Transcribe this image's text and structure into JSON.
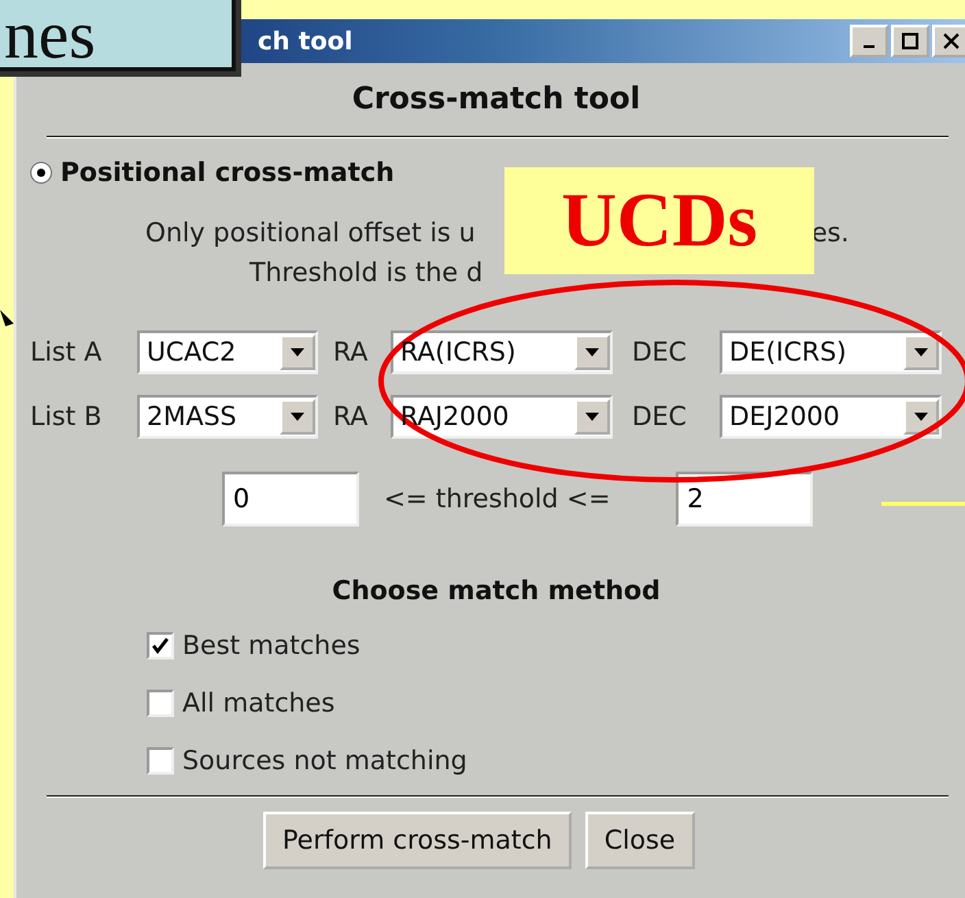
{
  "callout": {
    "text": "nes"
  },
  "window": {
    "title": "ch tool"
  },
  "heading": "Cross-match tool",
  "mode": {
    "label": "Positional cross-match",
    "selected": true
  },
  "info_lines": [
    [
      "Only positional offset is u",
      "es."
    ],
    [
      "Threshold is the d"
    ]
  ],
  "label_overlay": {
    "text": "UCDs"
  },
  "lists": [
    {
      "label": "List A",
      "catalog": "UCAC2",
      "ra_label": "RA",
      "ra": "RA(ICRS)",
      "dec_label": "DEC",
      "dec": "DE(ICRS)"
    },
    {
      "label": "List B",
      "catalog": "2MASS",
      "ra_label": "RA",
      "ra": "RAJ2000",
      "dec_label": "DEC",
      "dec": "DEJ2000"
    }
  ],
  "threshold": {
    "min": "0",
    "label": "<= threshold <=",
    "max": "2"
  },
  "method_heading": "Choose match method",
  "methods": [
    {
      "label": "Best matches",
      "checked": true
    },
    {
      "label": "All matches",
      "checked": false
    },
    {
      "label": "Sources not matching",
      "checked": false
    }
  ],
  "buttons": [
    "Perform cross-match",
    "Close"
  ]
}
